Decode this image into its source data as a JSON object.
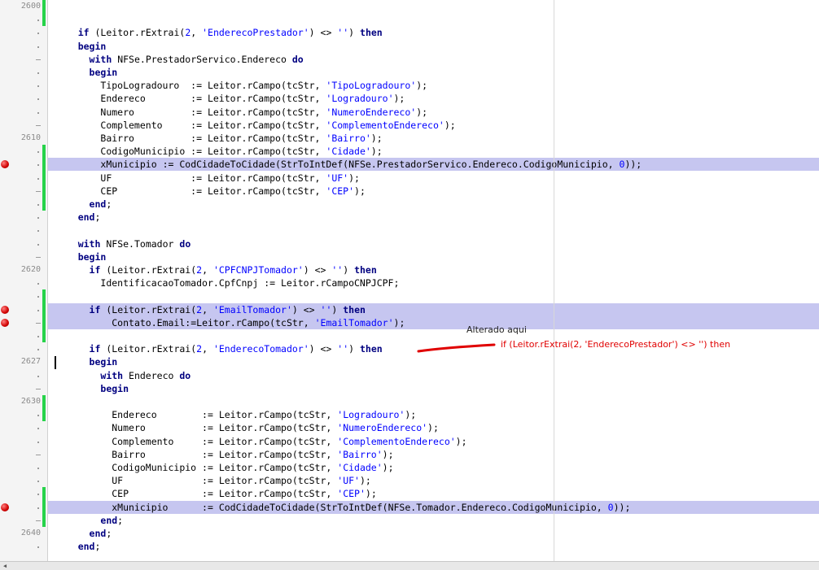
{
  "gutter": {
    "line_numbers": [
      {
        "label": "2600",
        "row": 0
      },
      {
        "label": "2610",
        "row": 10
      },
      {
        "label": "2620",
        "row": 20
      },
      {
        "label": "2627",
        "row": 27
      },
      {
        "label": "2630",
        "row": 30
      },
      {
        "label": "2640",
        "row": 40
      }
    ]
  },
  "code_lines": [
    {
      "text": ""
    },
    {
      "text": ""
    },
    {
      "text": "    if (Leitor.rExtrai(2, 'EnderecoPrestador') <> '') then"
    },
    {
      "text": "    begin"
    },
    {
      "text": "      with NFSe.PrestadorServico.Endereco do"
    },
    {
      "text": "      begin"
    },
    {
      "text": "        TipoLogradouro  := Leitor.rCampo(tcStr, 'TipoLogradouro');"
    },
    {
      "text": "        Endereco        := Leitor.rCampo(tcStr, 'Logradouro');"
    },
    {
      "text": "        Numero          := Leitor.rCampo(tcStr, 'NumeroEndereco');"
    },
    {
      "text": "        Complemento     := Leitor.rCampo(tcStr, 'ComplementoEndereco');"
    },
    {
      "text": "        Bairro          := Leitor.rCampo(tcStr, 'Bairro');"
    },
    {
      "text": "        CodigoMunicipio := Leitor.rCampo(tcStr, 'Cidade');"
    },
    {
      "text": "        xMunicipio := CodCidadeToCidade(StrToIntDef(NFSe.PrestadorServico.Endereco.CodigoMunicipio, 0));",
      "highlight": true,
      "breakpoint": true
    },
    {
      "text": "        UF              := Leitor.rCampo(tcStr, 'UF');"
    },
    {
      "text": "        CEP             := Leitor.rCampo(tcStr, 'CEP');"
    },
    {
      "text": "      end;"
    },
    {
      "text": "    end;"
    },
    {
      "text": ""
    },
    {
      "text": "    with NFSe.Tomador do"
    },
    {
      "text": "    begin"
    },
    {
      "text": "      if (Leitor.rExtrai(2, 'CPFCNPJTomador') <> '') then"
    },
    {
      "text": "        IdentificacaoTomador.CpfCnpj := Leitor.rCampoCNPJCPF;"
    },
    {
      "text": ""
    },
    {
      "text": "      if (Leitor.rExtrai(2, 'EmailTomador') <> '') then",
      "highlight": true,
      "breakpoint": true
    },
    {
      "text": "          Contato.Email:=Leitor.rCampo(tcStr, 'EmailTomador');",
      "highlight": true,
      "breakpoint": true
    },
    {
      "text": ""
    },
    {
      "text": "      if (Leitor.rExtrai(2, 'EnderecoTomador') <> '') then"
    },
    {
      "text": "      begin"
    },
    {
      "text": "        with Endereco do"
    },
    {
      "text": "        begin"
    },
    {
      "text": ""
    },
    {
      "text": "          Endereco        := Leitor.rCampo(tcStr, 'Logradouro');"
    },
    {
      "text": "          Numero          := Leitor.rCampo(tcStr, 'NumeroEndereco');"
    },
    {
      "text": "          Complemento     := Leitor.rCampo(tcStr, 'ComplementoEndereco');"
    },
    {
      "text": "          Bairro          := Leitor.rCampo(tcStr, 'Bairro');"
    },
    {
      "text": "          CodigoMunicipio := Leitor.rCampo(tcStr, 'Cidade');"
    },
    {
      "text": "          UF              := Leitor.rCampo(tcStr, 'UF');"
    },
    {
      "text": "          CEP             := Leitor.rCampo(tcStr, 'CEP');"
    },
    {
      "text": "          xMunicipio      := CodCidadeToCidade(StrToIntDef(NFSe.Tomador.Endereco.CodigoMunicipio, 0));",
      "highlight": true,
      "breakpoint": true
    },
    {
      "text": "        end;"
    },
    {
      "text": "      end;"
    },
    {
      "text": "    end;"
    }
  ],
  "keywords": [
    "if",
    "then",
    "begin",
    "with",
    "do",
    "end"
  ],
  "annotation": {
    "title": "Alterado aqui",
    "code": "if (Leitor.rExtrai(2, 'EnderecoPrestador') <> '') then"
  },
  "colors": {
    "highlight": "#c6c6f0",
    "keyword": "#000080",
    "string": "#0000ff",
    "modified_bar": "#27d34a",
    "breakpoint": "#d00000",
    "annotation_red": "#e00000"
  }
}
